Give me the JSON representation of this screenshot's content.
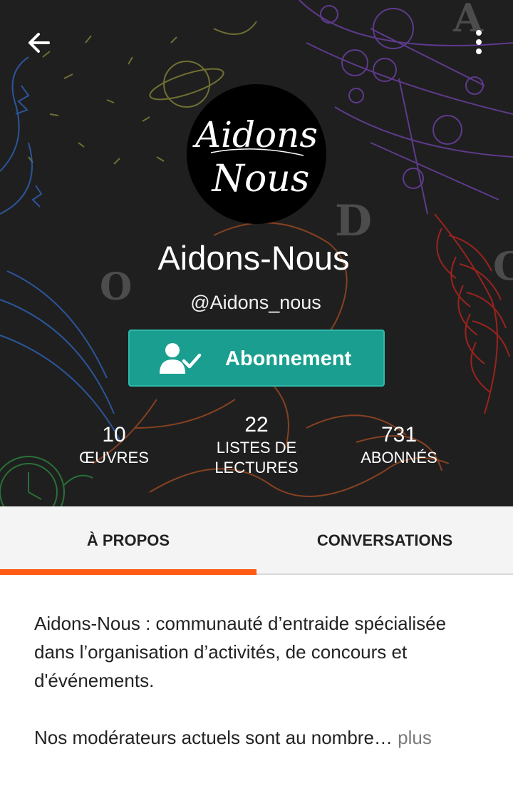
{
  "colors": {
    "header_bg": "#1f1f1f",
    "follow_button": "#1a9e8f",
    "tab_indicator": "#ff5a14",
    "more_link": "#7b7b7b"
  },
  "icons": {
    "back": "arrow-left-icon",
    "menu": "more-vertical-icon",
    "follow": "user-check-icon"
  },
  "profile": {
    "logo_text": [
      "Aidons",
      "Nous"
    ],
    "name": "Aidons-Nous",
    "handle": "@Aidons_nous",
    "follow_label": "Abonnement"
  },
  "stats": [
    {
      "value": "10",
      "label": "ŒUVRES"
    },
    {
      "value": "22",
      "label": "LISTES DE LECTURES"
    },
    {
      "value": "731",
      "label": "ABONNÉS"
    }
  ],
  "tabs": [
    {
      "label": "À PROPOS",
      "active": true
    },
    {
      "label": "CONVERSATIONS",
      "active": false
    }
  ],
  "about": {
    "paragraph1": "Aidons-Nous : communauté d’entraide spécialisée dans l’organisation d’activités, de concours et d'événements.",
    "paragraph2": "Nos modérateurs actuels sont au nombre…",
    "more_label": "plus"
  }
}
